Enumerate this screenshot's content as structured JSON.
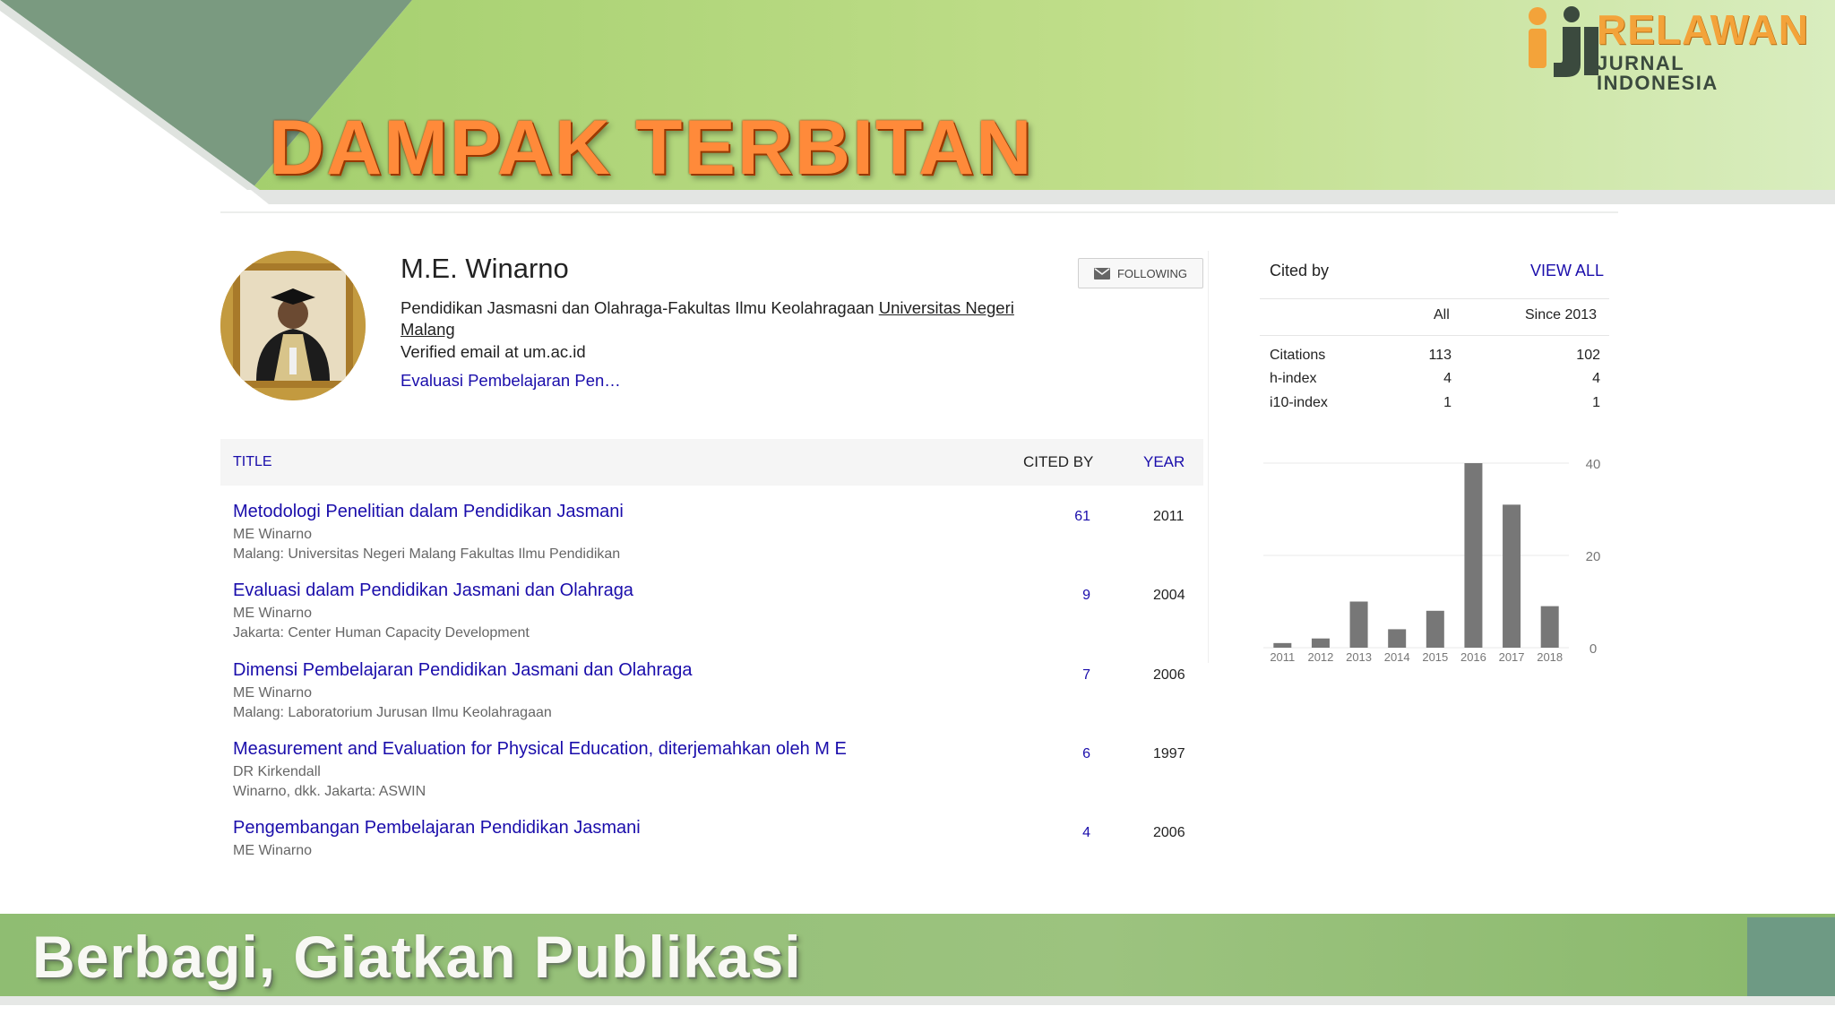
{
  "slide": {
    "title": "DAMPAK TERBITAN",
    "footer": "Berbagi, Giatkan Publikasi",
    "logo_word1": "RELAWAN",
    "logo_word2": "JURNAL INDONESIA"
  },
  "profile": {
    "name": "M.E. Winarno",
    "affiliation_prefix": "Pendidikan Jasmasni dan Olahraga-Fakultas Ilmu Keolahragaan ",
    "affiliation_link": "Universitas Negeri Malang",
    "email": "Verified email at um.ac.id",
    "interest": "Evaluasi Pembelajaran Pen…",
    "follow_label": "FOLLOWING",
    "follow_icon": "envelope-icon"
  },
  "table": {
    "header": {
      "title": "TITLE",
      "cited_by": "CITED BY",
      "year": "YEAR"
    },
    "rows": [
      {
        "title": "Metodologi Penelitian dalam Pendidikan Jasmani",
        "authors": "ME Winarno",
        "venue": "Malang: Universitas Negeri Malang Fakultas Ilmu Pendidikan",
        "cited_by": "61",
        "year": "2011"
      },
      {
        "title": "Evaluasi dalam Pendidikan Jasmani dan Olahraga",
        "authors": "ME Winarno",
        "venue": "Jakarta: Center Human Capacity Development",
        "cited_by": "9",
        "year": "2004"
      },
      {
        "title": "Dimensi Pembelajaran Pendidikan Jasmani dan Olahraga",
        "authors": "ME Winarno",
        "venue": "Malang: Laboratorium Jurusan Ilmu Keolahragaan",
        "cited_by": "7",
        "year": "2006"
      },
      {
        "title": "Measurement and Evaluation for Physical Education, diterjemahkan oleh M E",
        "authors": "DR Kirkendall",
        "venue": "Winarno, dkk. Jakarta: ASWIN",
        "cited_by": "6",
        "year": "1997"
      },
      {
        "title": "Pengembangan Pembelajaran Pendidikan Jasmani",
        "authors": "ME Winarno",
        "venue": "",
        "cited_by": "4",
        "year": "2006"
      }
    ]
  },
  "cited_by": {
    "heading": "Cited by",
    "view_all": "VIEW ALL",
    "col_all": "All",
    "col_since": "Since 2013",
    "metrics": [
      {
        "label": "Citations",
        "all": "113",
        "since": "102"
      },
      {
        "label": "h-index",
        "all": "4",
        "since": "4"
      },
      {
        "label": "i10-index",
        "all": "1",
        "since": "1"
      }
    ]
  },
  "chart_data": {
    "type": "bar",
    "categories": [
      "2011",
      "2012",
      "2013",
      "2014",
      "2015",
      "2016",
      "2017",
      "2018"
    ],
    "values": [
      1,
      2,
      10,
      4,
      8,
      40,
      31,
      9
    ],
    "ylim": [
      0,
      40
    ],
    "yticks": [
      0,
      20,
      40
    ],
    "bar_color": "#777777",
    "grid": true
  }
}
